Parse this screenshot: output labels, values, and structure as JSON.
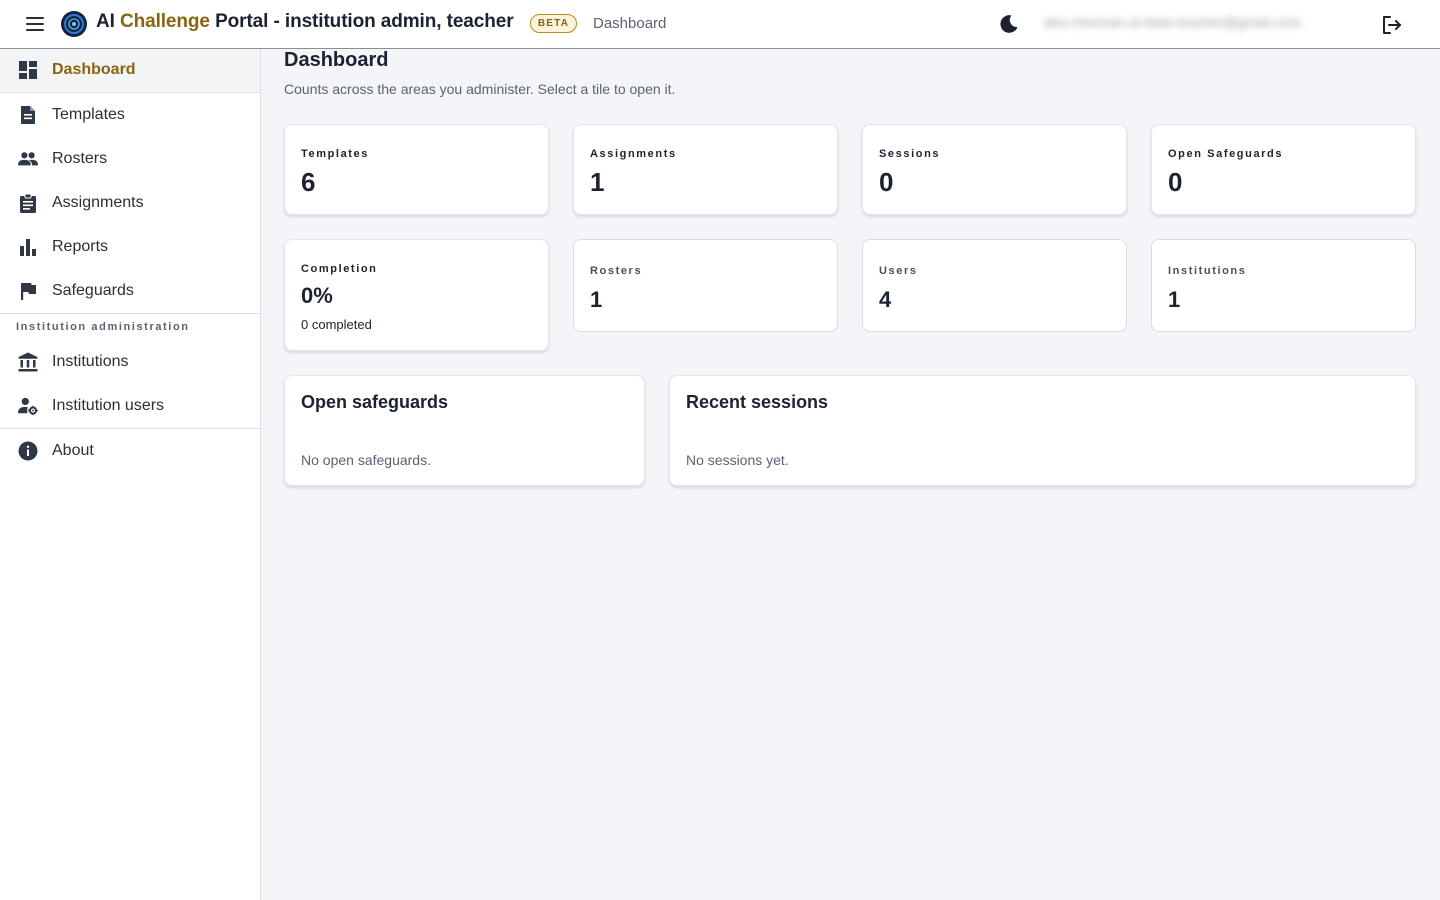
{
  "header": {
    "title_prefix": "AI ",
    "title_accent": "Challenge",
    "title_suffix": " Portal - institution admin, teacher",
    "badge": "BETA",
    "breadcrumb": "Dashboard",
    "user_email": "alex.freeman.ai-beta-teacher@gmail.com",
    "accent_color": "#8a6410"
  },
  "sidebar": {
    "items": [
      {
        "label": "Dashboard",
        "icon": "dashboard-icon",
        "active": true
      },
      {
        "label": "Templates",
        "icon": "document-icon"
      },
      {
        "label": "Rosters",
        "icon": "people-icon"
      },
      {
        "label": "Assignments",
        "icon": "clipboard-icon"
      },
      {
        "label": "Reports",
        "icon": "bar-chart-icon"
      },
      {
        "label": "Safeguards",
        "icon": "flag-icon"
      }
    ],
    "section_label": "Institution administration",
    "admin_items": [
      {
        "label": "Institutions",
        "icon": "institution-icon"
      },
      {
        "label": "Institution users",
        "icon": "user-settings-icon"
      }
    ],
    "about": {
      "label": "About",
      "icon": "info-icon"
    }
  },
  "main": {
    "title": "Dashboard",
    "subtitle": "Counts across the areas you administer. Select a tile to open it.",
    "tiles": [
      {
        "label": "Templates",
        "value": "6"
      },
      {
        "label": "Assignments",
        "value": "1"
      },
      {
        "label": "Sessions",
        "value": "0"
      },
      {
        "label": "Open Safeguards",
        "value": "0"
      },
      {
        "label": "Completion",
        "value": "0%",
        "sub": "0 completed"
      },
      {
        "label": "Rosters",
        "value": "1"
      },
      {
        "label": "Users",
        "value": "4"
      },
      {
        "label": "Institutions",
        "value": "1"
      }
    ],
    "panels": {
      "safeguards": {
        "title": "Open safeguards",
        "empty": "No open safeguards."
      },
      "sessions": {
        "title": "Recent sessions",
        "empty": "No sessions yet."
      }
    }
  }
}
